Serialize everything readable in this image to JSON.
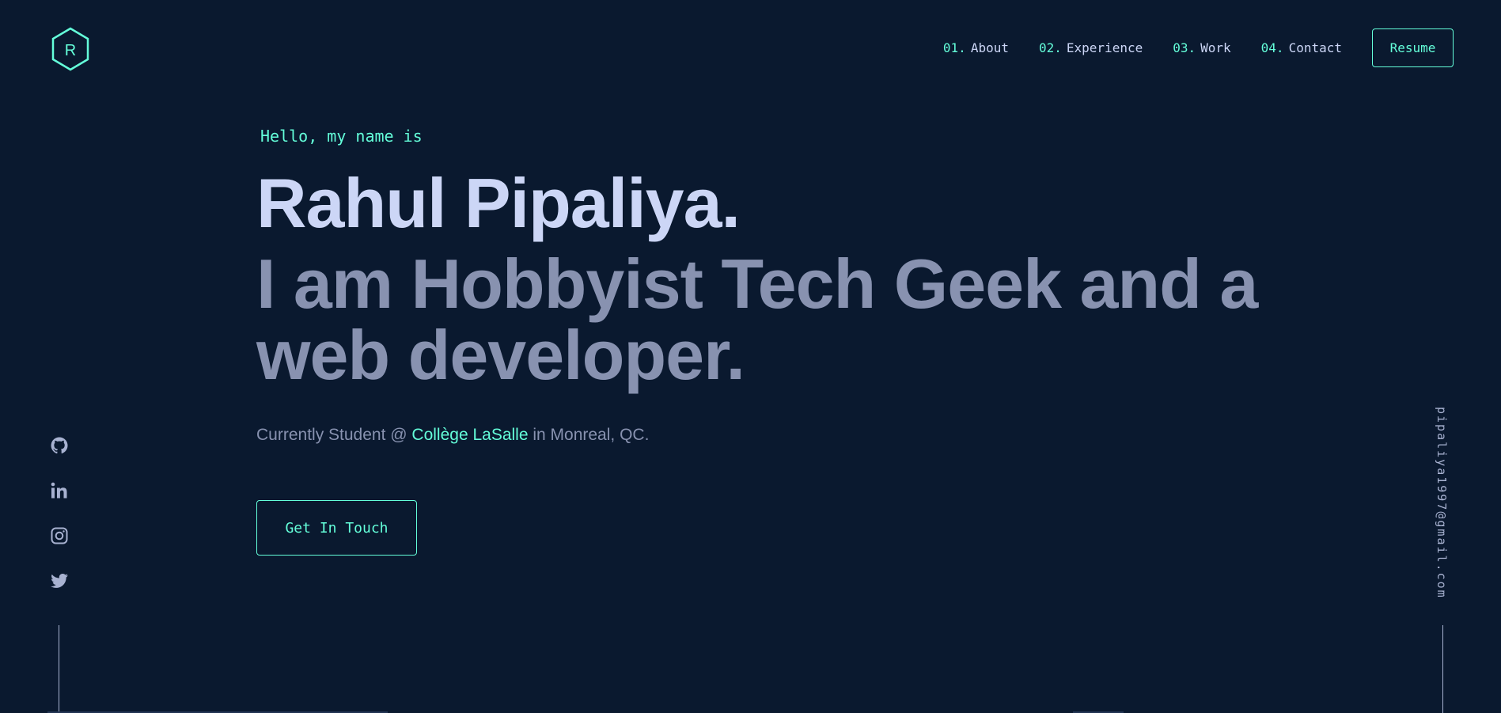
{
  "header": {
    "logo_letter": "R",
    "nav": [
      {
        "num": "01.",
        "label": "About"
      },
      {
        "num": "02.",
        "label": "Experience"
      },
      {
        "num": "03.",
        "label": "Work"
      },
      {
        "num": "04.",
        "label": "Contact"
      }
    ],
    "resume_label": "Resume"
  },
  "hero": {
    "greeting": "Hello, my name is",
    "name": "Rahul Pipaliya.",
    "tagline": "I am Hobbyist Tech Geek and a web developer.",
    "subtitle_prefix": "Currently Student @ ",
    "subtitle_link": "Collège LaSalle",
    "subtitle_suffix": " in Monreal, QC.",
    "cta_label": "Get In Touch"
  },
  "socials": {
    "icons": [
      "github-icon",
      "linkedin-icon",
      "instagram-icon",
      "twitter-icon"
    ]
  },
  "email": "pipaliya1997@gmail.com",
  "colors": {
    "background": "#0a192f",
    "accent": "#64ffda",
    "heading": "#ccd6f6",
    "text": "#8892b0"
  }
}
